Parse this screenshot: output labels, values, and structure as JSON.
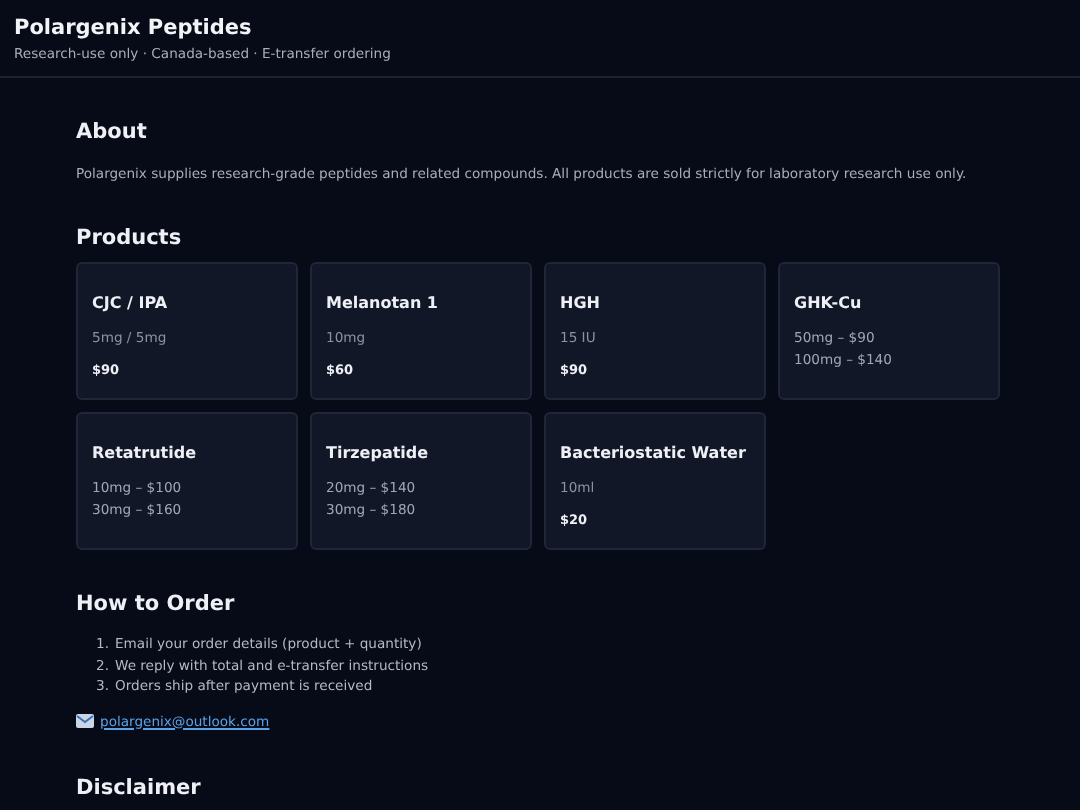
{
  "header": {
    "title": "Polargenix Peptides",
    "tagline": "Research-use only · Canada-based · E-transfer ordering"
  },
  "about": {
    "heading": "About",
    "text": "Polargenix supplies research-grade peptides and related compounds. All products are sold strictly for laboratory research use only."
  },
  "products": {
    "heading": "Products",
    "items": [
      {
        "kind": "single",
        "name": "CJC / IPA",
        "spec": "5mg / 5mg",
        "price": "$90"
      },
      {
        "kind": "single",
        "name": "Melanotan 1",
        "spec": "10mg",
        "price": "$60"
      },
      {
        "kind": "single",
        "name": "HGH",
        "spec": "15 IU",
        "price": "$90"
      },
      {
        "kind": "options",
        "name": "GHK-Cu",
        "options": [
          "50mg – $90",
          "100mg – $140"
        ]
      },
      {
        "kind": "options",
        "name": "Retatrutide",
        "options": [
          "10mg – $100",
          "30mg – $160"
        ]
      },
      {
        "kind": "options",
        "name": "Tirzepatide",
        "options": [
          "20mg – $140",
          "30mg – $180"
        ]
      },
      {
        "kind": "single",
        "name": "Bacteriostatic Water",
        "spec": "10ml",
        "price": "$20"
      }
    ]
  },
  "order": {
    "heading": "How to Order",
    "steps": [
      {
        "number": "1.",
        "text": "Email your order details (product + quantity)"
      },
      {
        "number": "2.",
        "text": "We reply with total and e-transfer instructions"
      },
      {
        "number": "3.",
        "text": "Orders ship after payment is received"
      }
    ],
    "email": "polargenix@outlook.com"
  },
  "disclaimer": {
    "heading": "Disclaimer"
  }
}
